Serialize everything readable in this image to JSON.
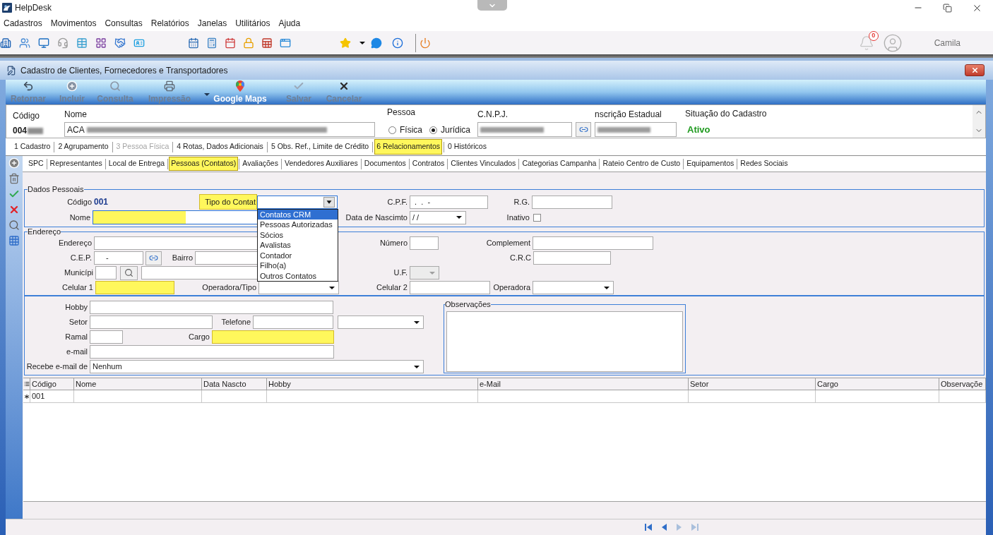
{
  "app": {
    "title": "HelpDesk",
    "menu": [
      "Cadastros",
      "Movimentos",
      "Consultas",
      "Relatórios",
      "Janelas",
      "Utilitários",
      "Ajuda"
    ],
    "notifications": "0",
    "user": "Camila"
  },
  "window": {
    "title": "Cadastro de Clientes, Fornecedores e Transportadores"
  },
  "actions": [
    {
      "label": "Retornar",
      "disabled": true,
      "dropdown": false
    },
    {
      "label": "Incluir",
      "disabled": true,
      "dropdown": false
    },
    {
      "label": "Consulta",
      "disabled": true,
      "dropdown": false
    },
    {
      "label": "Impressão",
      "disabled": true,
      "dropdown": true
    },
    {
      "label": "Google Maps",
      "disabled": false,
      "dropdown": false
    },
    {
      "label": "Salvar",
      "disabled": true,
      "dropdown": false
    },
    {
      "label": "Cancelar",
      "disabled": true,
      "dropdown": false
    }
  ],
  "header": {
    "codigo": {
      "label": "Código",
      "value": "004"
    },
    "nome": {
      "label": "Nome",
      "value": "ACA"
    },
    "pessoa": {
      "label": "Pessoa",
      "options": [
        {
          "label": "Física",
          "selected": false
        },
        {
          "label": "Jurídica",
          "selected": true
        }
      ]
    },
    "cnpj": {
      "label": "C.N.P.J."
    },
    "inscricao": {
      "label": "nscrição Estadual"
    },
    "situacao": {
      "label": "Situação do Cadastro",
      "value": "Ativo"
    }
  },
  "tabs": [
    {
      "label": "1 Cadastro",
      "selected": false,
      "disabled": false
    },
    {
      "label": "2 Agrupamento",
      "selected": false,
      "disabled": false
    },
    {
      "label": "3 Pessoa Física",
      "selected": false,
      "disabled": true
    },
    {
      "label": "4 Rotas, Dados Adicionais",
      "selected": false,
      "disabled": false
    },
    {
      "label": "5 Obs. Ref., Limite de Crédito",
      "selected": false,
      "disabled": false
    },
    {
      "label": "6 Relacionamentos",
      "selected": true,
      "disabled": false
    },
    {
      "label": "0 Históricos",
      "selected": false,
      "disabled": false
    }
  ],
  "subtabs": [
    {
      "label": "SPC",
      "selected": false
    },
    {
      "label": "Representantes",
      "selected": false
    },
    {
      "label": "Local de Entrega",
      "selected": false
    },
    {
      "label": "Pessoas (Contatos)",
      "selected": true
    },
    {
      "label": "Avaliações",
      "selected": false
    },
    {
      "label": "Vendedores Auxiliares",
      "selected": false
    },
    {
      "label": "Documentos",
      "selected": false
    },
    {
      "label": "Contratos",
      "selected": false
    },
    {
      "label": "Clientes Vinculados",
      "selected": false
    },
    {
      "label": "Categorias Campanha",
      "selected": false
    },
    {
      "label": "Rateio Centro de Custo",
      "selected": false
    },
    {
      "label": "Equipamentos",
      "selected": false
    },
    {
      "label": "Redes Sociais",
      "selected": false
    }
  ],
  "dados_pessoais": {
    "legend": "Dados Pessoais",
    "codigo": {
      "label": "Código",
      "value": "001"
    },
    "tipo_contato": {
      "label": "Tipo do Contat",
      "highlighted": true,
      "focused": true,
      "expanded": true,
      "options": [
        {
          "label": "Contatos CRM",
          "selected": true
        },
        {
          "label": "Pessoas Autorizadas",
          "selected": false
        },
        {
          "label": "Sócios",
          "selected": false
        },
        {
          "label": "Avalistas",
          "selected": false
        },
        {
          "label": "Contador",
          "selected": false
        },
        {
          "label": "Filho(a)",
          "selected": false
        },
        {
          "label": "Outros Contatos",
          "selected": false
        }
      ]
    },
    "cpf": {
      "label": "C.P.F.",
      "value": " .  .  -"
    },
    "rg": {
      "label": "R.G."
    },
    "nome": {
      "label": "Nome",
      "highlighted": true,
      "focused": true
    },
    "nascimento": {
      "label": "Data de Nascimto",
      "value": "/ /"
    },
    "inativo": {
      "label": "Inativo",
      "checked": false
    }
  },
  "endereco": {
    "legend": "Endereço",
    "endereco": {
      "label": "Endereço"
    },
    "numero": {
      "label": "Número"
    },
    "complemento": {
      "label": "Complement"
    },
    "cep": {
      "label": "C.E.P.",
      "value": "-"
    },
    "bairro": {
      "label": "Bairro"
    },
    "crc": {
      "label": "C.R.C"
    },
    "municipio": {
      "label": "Municípi"
    },
    "uf": {
      "label": "U.F.",
      "disabled": true
    },
    "celular1": {
      "label": "Celular 1",
      "highlighted": true
    },
    "operadora_tipo": {
      "label": "Operadora/Tipo"
    },
    "celular2": {
      "label": "Celular 2"
    },
    "operadora": {
      "label": "Operadora"
    }
  },
  "contato": {
    "hobby": {
      "label": "Hobby"
    },
    "setor": {
      "label": "Setor"
    },
    "telefone": {
      "label": "Telefone"
    },
    "ramal": {
      "label": "Ramal"
    },
    "cargo": {
      "label": "Cargo",
      "highlighted": true
    },
    "email": {
      "label": "e-mail"
    },
    "recebe_email": {
      "label": "Recebe e-mail de",
      "value": "Nenhum"
    }
  },
  "observacoes": {
    "legend": "Observações"
  },
  "grid": {
    "columns": [
      "Código",
      "Nome",
      "Data Nascto",
      "Hobby",
      "e-Mail",
      "Setor",
      "Cargo",
      "Observaçõe"
    ],
    "rows": [
      {
        "new": true,
        "cells": [
          "001"
        ]
      }
    ]
  },
  "navigator": [
    {
      "kind": "first",
      "disabled": false
    },
    {
      "kind": "prev",
      "disabled": false
    },
    {
      "kind": "next",
      "disabled": true
    },
    {
      "kind": "last",
      "disabled": true
    }
  ]
}
